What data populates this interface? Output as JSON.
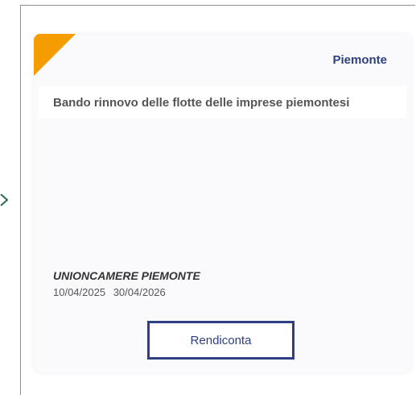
{
  "nav": {
    "arrow_icon": "chevron-right-icon"
  },
  "card": {
    "region": "Piemonte",
    "title": "Bando rinnovo delle flotte delle imprese piemontesi",
    "organization": "UNIONCAMERE PIEMONTE",
    "date_start": "10/04/2025",
    "date_end": "30/04/2026",
    "action_label": "Rendiconta",
    "accent_color": "#f59c00",
    "brand_color": "#2d3f80"
  }
}
